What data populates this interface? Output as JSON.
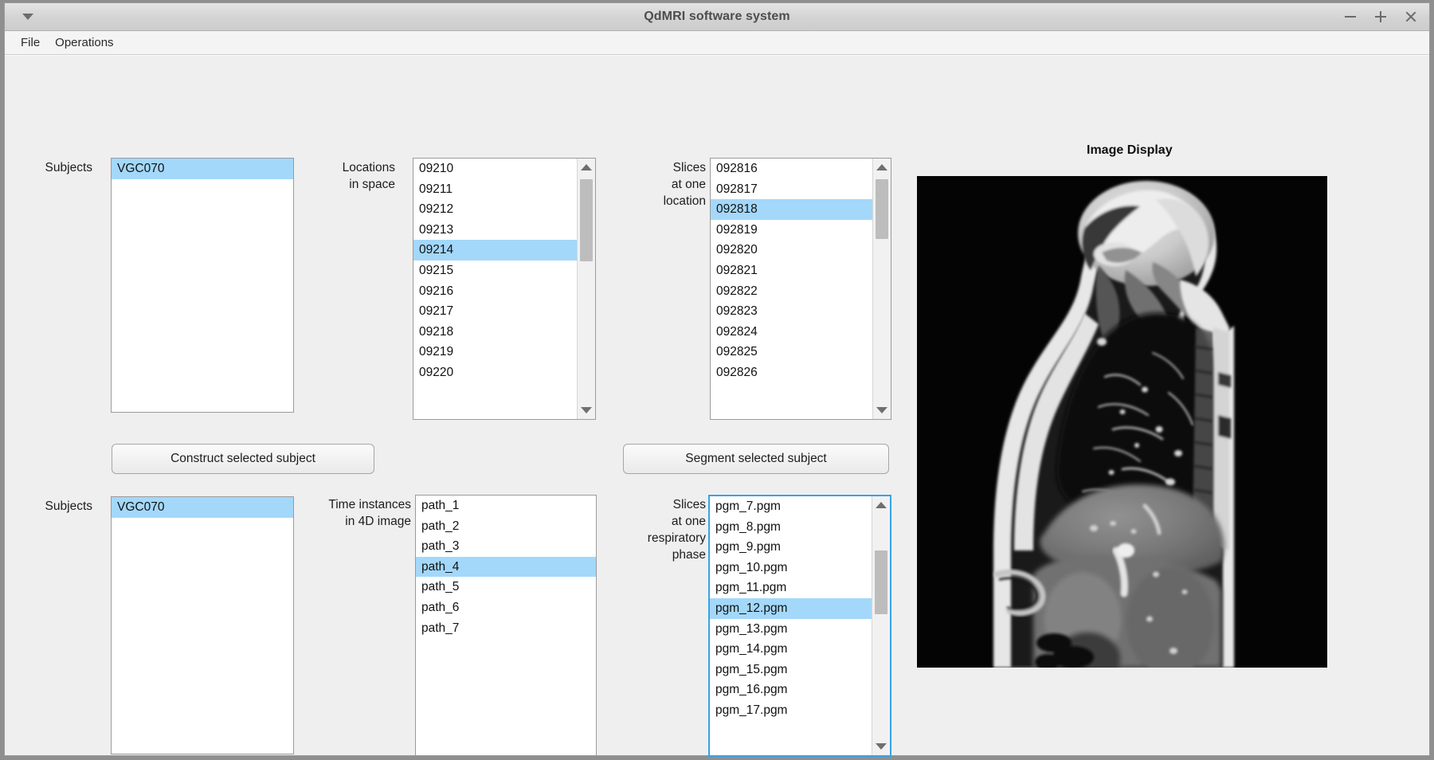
{
  "window": {
    "title": "QdMRI software system",
    "controls": {
      "menu_caret": "window-menu-caret",
      "minimize": "minimize",
      "maximize": "maximize",
      "close": "close"
    }
  },
  "menubar": {
    "items": [
      {
        "label": "File"
      },
      {
        "label": "Operations"
      }
    ]
  },
  "panels": {
    "top": {
      "subjects": {
        "label": "Subjects",
        "items": [
          "VGC070"
        ],
        "selected_index": 0
      },
      "locations": {
        "label": "Locations\nin space",
        "items": [
          "09210",
          "09211",
          "09212",
          "09213",
          "09214",
          "09215",
          "09216",
          "09217",
          "09218",
          "09219",
          "09220"
        ],
        "selected_index": 4,
        "scrollbar": {
          "position": "near-top"
        }
      },
      "slices_at_location": {
        "label": "Slices\nat one\nlocation",
        "items": [
          "092816",
          "092817",
          "092818",
          "092819",
          "092820",
          "092821",
          "092822",
          "092823",
          "092824",
          "092825",
          "092826"
        ],
        "selected_index": 2,
        "scrollbar": {
          "position": "near-top"
        }
      },
      "construct_button": "Construct selected subject",
      "segment_button": "Segment selected subject"
    },
    "bottom": {
      "subjects": {
        "label": "Subjects",
        "items": [
          "VGC070"
        ],
        "selected_index": 0
      },
      "time_instances": {
        "label": "Time instances\nin 4D image",
        "items": [
          "path_1",
          "path_2",
          "path_3",
          "path_4",
          "path_5",
          "path_6",
          "path_7"
        ],
        "selected_index": 3
      },
      "slices_at_phase": {
        "label": "Slices\nat one\nrespiratory\nphase",
        "items": [
          "pgm_7.pgm",
          "pgm_8.pgm",
          "pgm_9.pgm",
          "pgm_10.pgm",
          "pgm_11.pgm",
          "pgm_12.pgm",
          "pgm_13.pgm",
          "pgm_14.pgm",
          "pgm_15.pgm",
          "pgm_16.pgm",
          "pgm_17.pgm"
        ],
        "selected_index": 5,
        "focused": true,
        "scrollbar": {
          "position": "upper-middle"
        }
      }
    },
    "image_display": {
      "title": "Image Display",
      "content_description": "sagittal MRI slice of torso"
    }
  },
  "colors": {
    "selection": "#a3d8fa",
    "focus_border": "#37a3e8",
    "window_background": "#efefef",
    "listbox_background": "#ffffff",
    "title_text": "#4d4d4d"
  }
}
